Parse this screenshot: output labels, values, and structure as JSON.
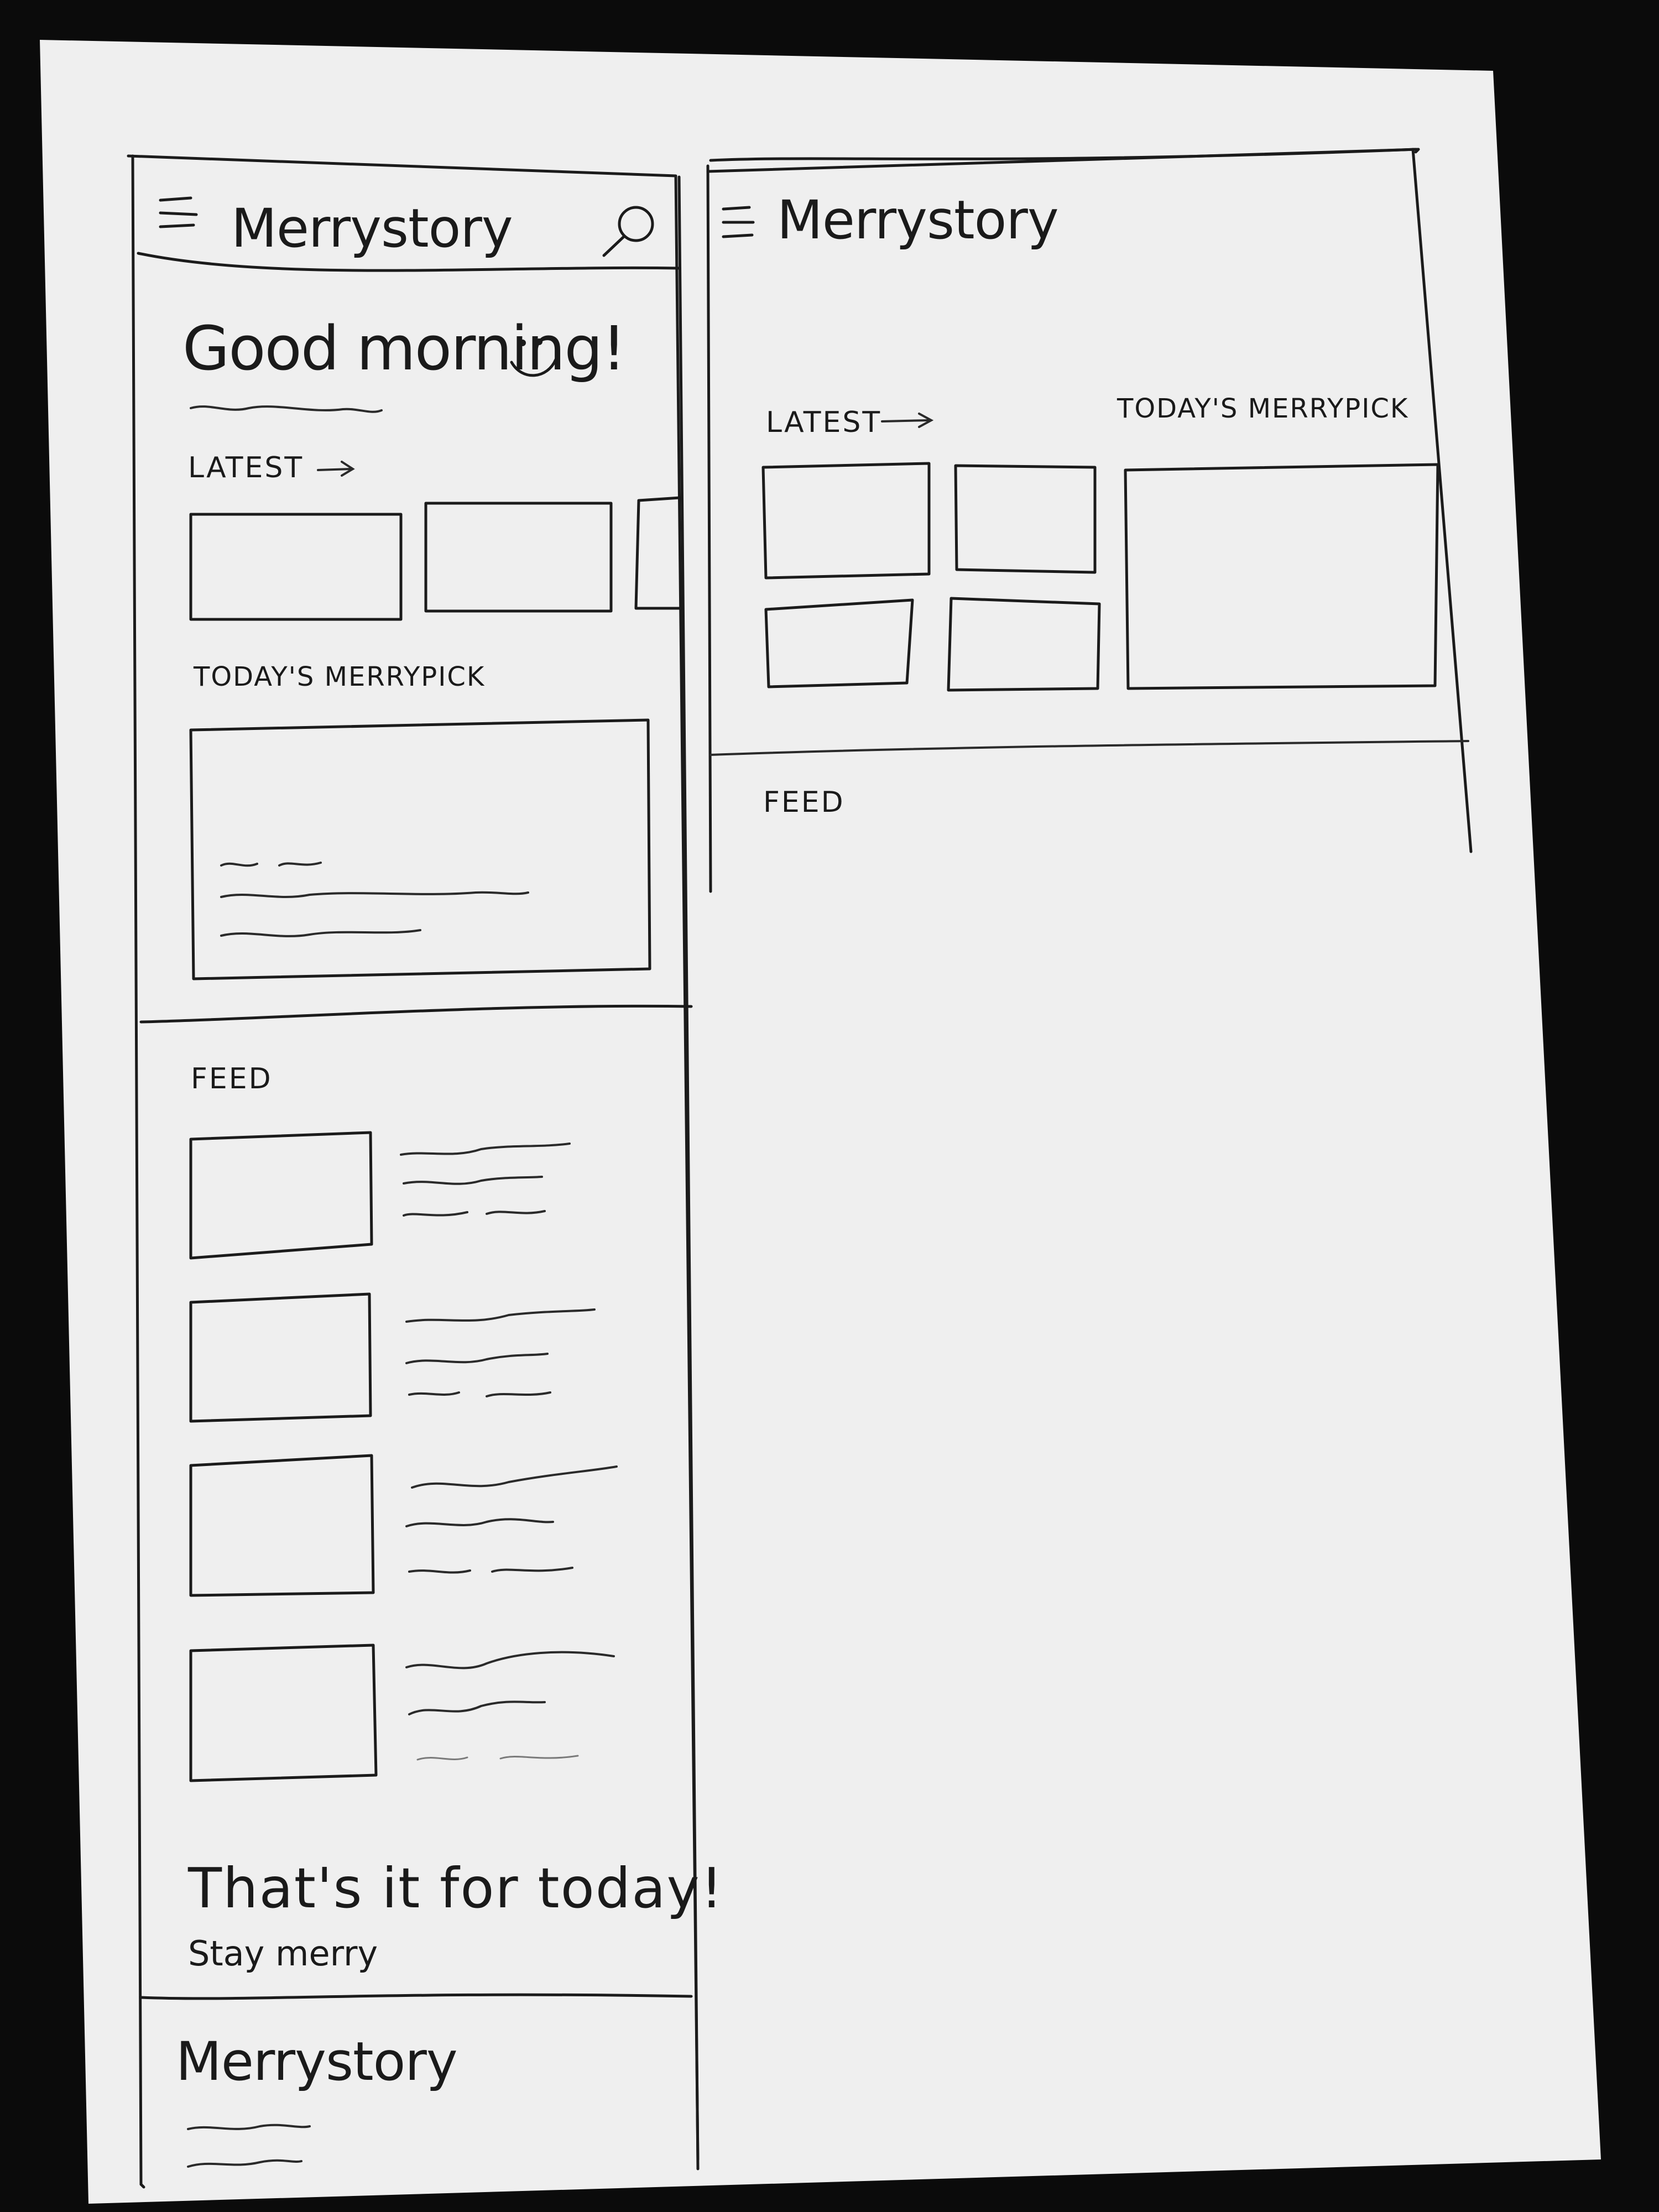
{
  "mobile": {
    "header": {
      "menu_icon": "hamburger-menu-icon",
      "title": "Merrystory",
      "search_icon": "search-icon"
    },
    "greeting": "Good morning!",
    "greeting_icon": "smiley-face-icon",
    "latest_label": "LATEST",
    "latest_arrow": "→",
    "merrypick_label": "TODAY'S MERRYPICK",
    "feed_label": "FEED",
    "end_title": "That's it for today!",
    "end_subtitle": "Stay merry",
    "footer_title": "Merrystory"
  },
  "tablet": {
    "header": {
      "menu_icon": "hamburger-menu-icon",
      "title": "Merrystory"
    },
    "latest_label": "LATEST",
    "latest_arrow": "→",
    "merrypick_label": "TODAY'S MERRYPICK",
    "feed_label": "FEED"
  }
}
